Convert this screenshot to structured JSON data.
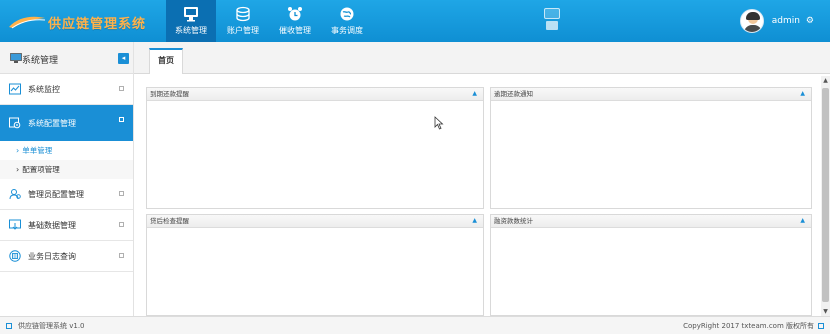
{
  "header": {
    "logo_text": "供应链管理系统",
    "nav": [
      {
        "label": "系统管理",
        "icon": "monitor-icon",
        "active": true
      },
      {
        "label": "账户管理",
        "icon": "coins-icon",
        "active": false
      },
      {
        "label": "催收管理",
        "icon": "alarm-clock-icon",
        "active": false
      },
      {
        "label": "事务调度",
        "icon": "globe-icon",
        "active": false
      }
    ],
    "user_name": "admin",
    "user_icon": "⚙"
  },
  "sidebar": {
    "title": "系统管理",
    "collapse_icon": "◂",
    "items": [
      {
        "label": "系统监控",
        "icon": "chart-icon"
      },
      {
        "label": "系统配置管理",
        "icon": "config-icon",
        "active": true
      },
      {
        "label": "管理员配置管理",
        "icon": "users-icon"
      },
      {
        "label": "基础数据管理",
        "icon": "import-icon"
      },
      {
        "label": "业务日志查询",
        "icon": "log-icon"
      }
    ],
    "submenu": [
      {
        "label": "单单管理",
        "active": true
      },
      {
        "label": "配置项管理",
        "active": false
      }
    ]
  },
  "main": {
    "tab_label": "首页",
    "panels": [
      {
        "title": "到期还款提醒"
      },
      {
        "title": "逾期还款通知"
      },
      {
        "title": "贷后检查提醒"
      },
      {
        "title": "融资款数统计"
      }
    ],
    "panel_toggle": "▲",
    "scroll_up": "▲",
    "scroll_down": "▼"
  },
  "footer": {
    "left_text": "供应链管理系统 v1.0",
    "right_text": "CopyRight 2017 txteam.com 版权所有"
  },
  "colors": {
    "header": "#1fa6e6",
    "accent": "#1a8fd6",
    "logo": "#ffb24a"
  }
}
